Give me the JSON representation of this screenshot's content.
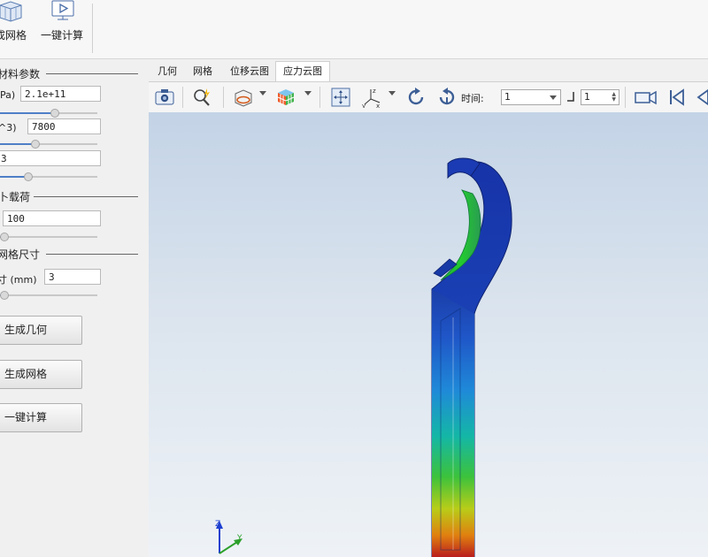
{
  "ribbon": {
    "buttons": [
      {
        "label": "成网格",
        "icon": "mesh-cube-icon"
      },
      {
        "label": "一键计算",
        "icon": "play-monitor-icon"
      }
    ]
  },
  "left_panel": {
    "material": {
      "title": "材料参数",
      "fields": [
        {
          "label": "Pa)",
          "value": "2.1e+11"
        },
        {
          "label": "^3)",
          "value": "7800"
        },
        {
          "label": "",
          "value": "3"
        }
      ]
    },
    "load": {
      "title": "卜载荷",
      "fields": [
        {
          "label": "",
          "value": "100"
        }
      ]
    },
    "mesh": {
      "title": "网格尺寸",
      "fields": [
        {
          "label": "寸 (mm)",
          "value": "3"
        }
      ]
    },
    "slider_levels": [
      0.55,
      0.35,
      0.28,
      0.02,
      0.02
    ],
    "buttons": {
      "gen_geometry": "生成几何",
      "gen_mesh": "生成网格",
      "compute": "一键计算"
    }
  },
  "tabs": [
    {
      "label": "几何",
      "active": false
    },
    {
      "label": "网格",
      "active": false
    },
    {
      "label": "位移云图",
      "active": false
    },
    {
      "label": "应力云图",
      "active": true
    }
  ],
  "toolbar": {
    "time_label": "时间:",
    "time_value": "1",
    "step_value": "1",
    "icons": [
      "camera-icon",
      "zoom-icon",
      "section-view-icon",
      "color-cube-icon",
      "fit-view-icon",
      "axes-icon",
      "rotate-ccw-icon",
      "rotate-cw-icon",
      "record-video-icon",
      "first-frame-icon",
      "prev-frame-icon"
    ]
  },
  "viewport": {
    "axes_labels": {
      "z": "Z",
      "y": "Y"
    },
    "colors": {
      "accent": "#4f7fc7",
      "bg_top": "#c3d3e6",
      "bg_bottom": "#eef2f6"
    }
  }
}
